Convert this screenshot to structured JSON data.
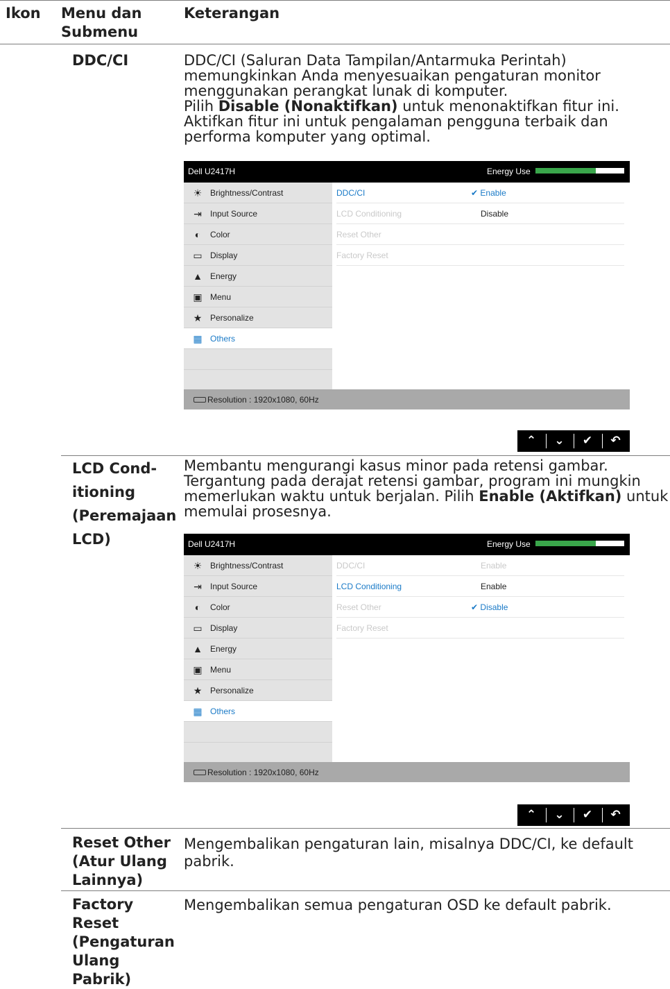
{
  "header": {
    "icon_col": "Ikon",
    "menu_col": "Menu dan Submenu",
    "desc_col": "Keterangan"
  },
  "rows": [
    {
      "label": "DDC/CI",
      "desc_p1": "DDC/CI (Saluran Data Tampilan/Antarmuka Perintah) memungkinkan Anda menyesuaikan pengaturan monitor menggunakan perangkat lunak di komputer.",
      "desc_p2_pre": "Pilih ",
      "desc_p2_bold": "Disable (Nonaktifkan)",
      "desc_p2_post": " untuk menonaktifkan fitur ini. Aktifkan fitur ini untuk pengalaman pengguna terbaik dan performa komputer yang optimal."
    },
    {
      "label_lines": [
        "LCD Cond-",
        "itioning",
        "(Peremajaan",
        "LCD)"
      ],
      "desc_pre": "Membantu mengurangi kasus minor pada retensi gambar. Tergantung pada derajat retensi gambar, program ini mungkin memerlukan waktu untuk berjalan. Pilih ",
      "desc_bold": "Enable (Aktifkan)",
      "desc_post": " untuk memulai prosesnya."
    },
    {
      "label": "Reset Other (Atur Ulang Lainnya)",
      "desc": "Mengembalikan pengaturan lain, misalnya DDC/CI, ke default pabrik."
    },
    {
      "label": "Factory Reset (Pengaturan Ulang Pabrik)",
      "desc": "Mengembalikan semua pengaturan OSD ke default pabrik."
    }
  ],
  "osd": {
    "model": "Dell U2417H",
    "energy_label": "Energy Use",
    "energy_level": 0.68,
    "energy_color": "#3aa64b",
    "accent_color": "#1a7ac7",
    "menu": [
      {
        "label": "Brightness/Contrast",
        "icon": "sun-icon"
      },
      {
        "label": "Input Source",
        "icon": "input-source-icon"
      },
      {
        "label": "Color",
        "icon": "color-icon"
      },
      {
        "label": "Display",
        "icon": "monitor-icon"
      },
      {
        "label": "Energy",
        "icon": "energy-icon"
      },
      {
        "label": "Menu",
        "icon": "menu-icon"
      },
      {
        "label": "Personalize",
        "icon": "star-icon"
      },
      {
        "label": "Others",
        "icon": "others-icon"
      }
    ],
    "resolution": "Resolution : 1920x1080, 60Hz",
    "settings": [
      "DDC/CI",
      "LCD Conditioning",
      "Reset Other",
      "Factory Reset"
    ],
    "shot1": {
      "opt1": "Enable",
      "opt2": "Disable"
    },
    "shot2": {
      "ddc_val": "Enable",
      "lcd_val": "Enable",
      "opt_disable": "Disable"
    },
    "check_glyph": "✔",
    "buttons": [
      {
        "name": "up-arrow-icon",
        "glyph": "⌃"
      },
      {
        "name": "down-arrow-icon",
        "glyph": "⌄"
      },
      {
        "name": "checkmark-icon",
        "glyph": "✔"
      },
      {
        "name": "back-icon",
        "glyph": "↶"
      }
    ]
  }
}
